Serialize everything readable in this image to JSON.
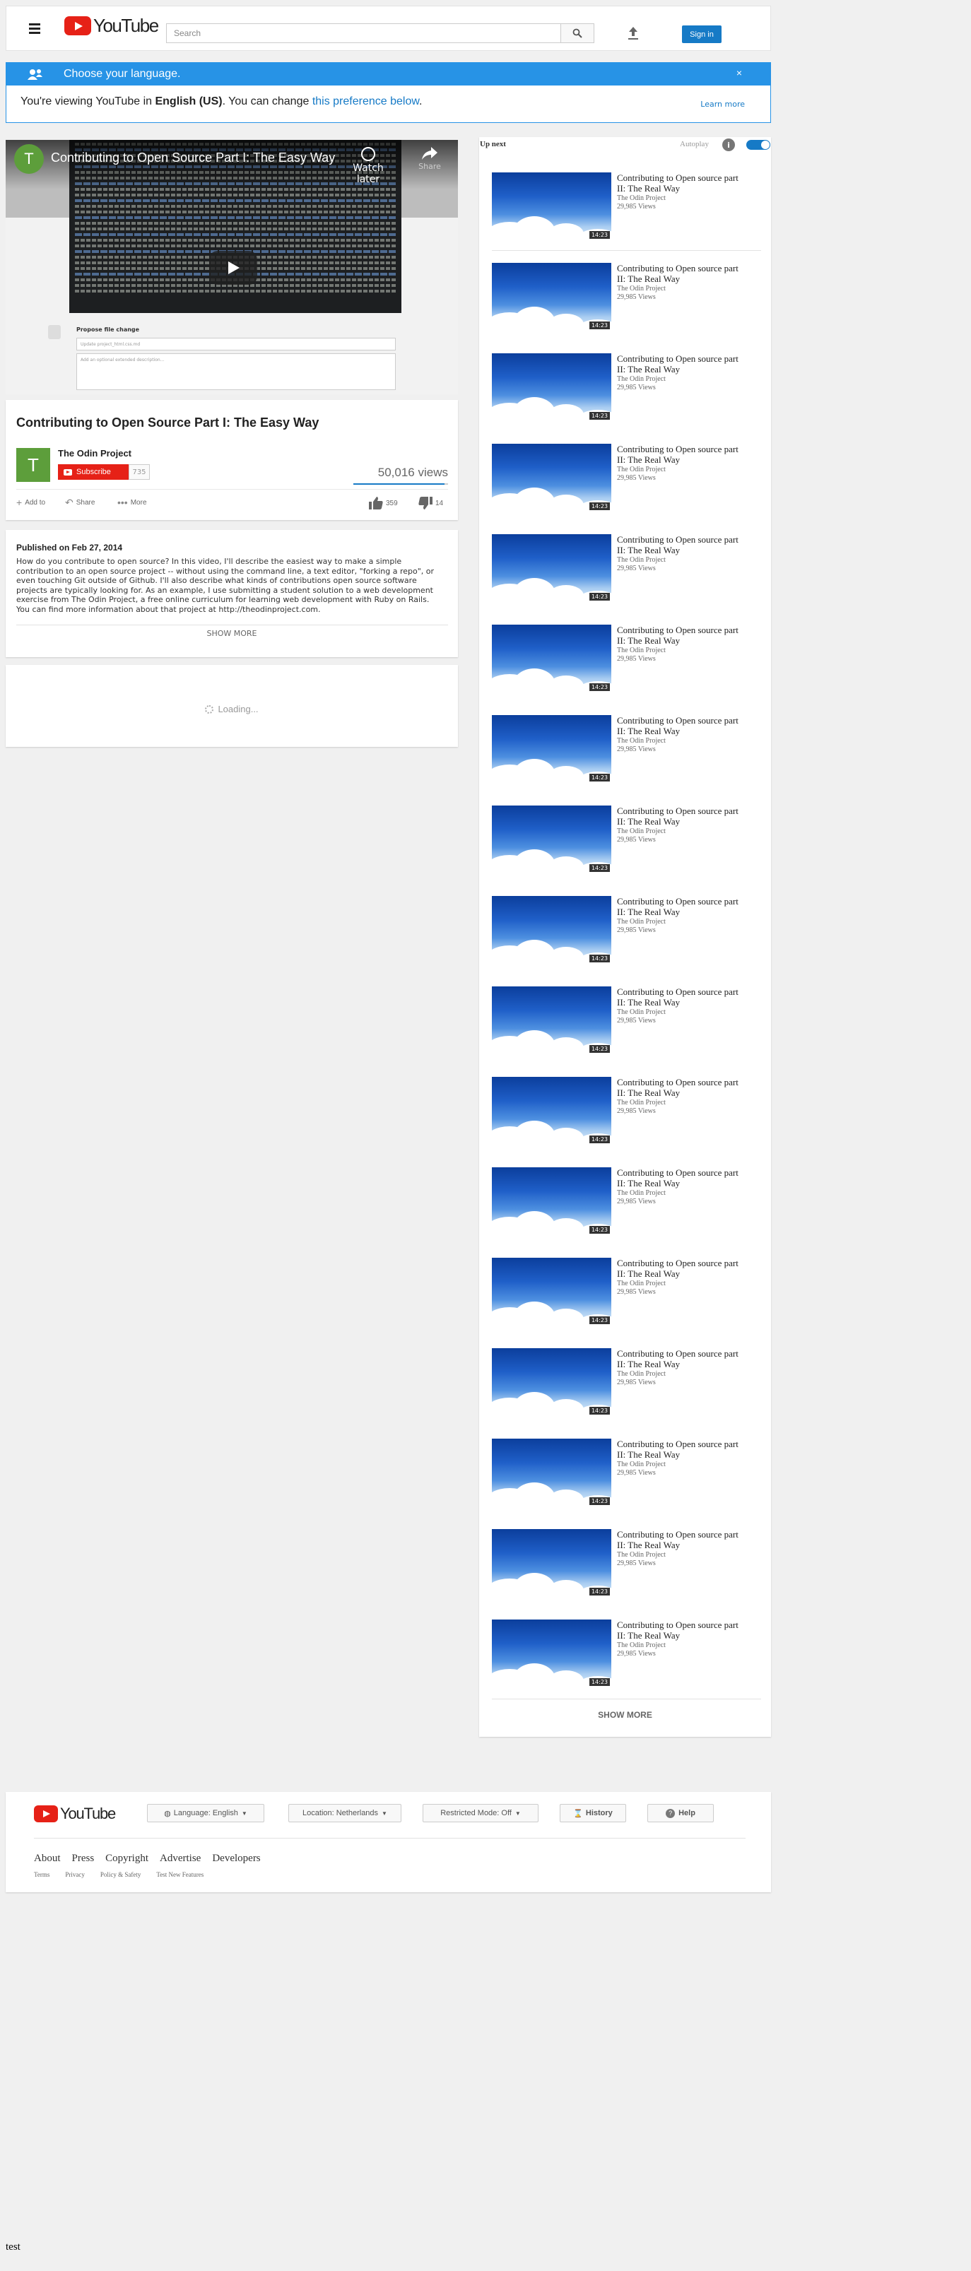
{
  "header": {
    "logo_text": "YouTube",
    "search_placeholder": "Search",
    "signin_label": "Sign in"
  },
  "language_banner": {
    "title": "Choose your language.",
    "close": "×",
    "body_prefix": "You're viewing YouTube in ",
    "body_language": "English (US)",
    "body_middle": ". You can change ",
    "body_link": "this preference below",
    "body_suffix": ".",
    "learn_more": "Learn more"
  },
  "player": {
    "channel_initial": "T",
    "title": "Contributing to Open Source Part I: The Easy Way",
    "watch_later": "Watch later",
    "share": "Share",
    "propose_label": "Propose file change",
    "field1_placeholder": "Update project_html.css.md",
    "field2_placeholder": "Add an optional extended description..."
  },
  "video_info": {
    "title": "Contributing to Open Source Part I: The Easy Way",
    "channel_initial": "T",
    "channel_name": "The Odin Project",
    "subscribe_label": "Subscribe",
    "subscriber_count": "735",
    "views": "50,016 views",
    "like_ratio": 0.96,
    "add_to": "Add to",
    "share": "Share",
    "more": "More",
    "likes": "359",
    "dislikes": "14"
  },
  "description": {
    "published": "Published on Feb 27, 2014",
    "text": "How do you contribute to open source? In this video, I'll describe the easiest way to make a simple contribution to an open source project -- without using the command line, a text editor, \"forking a repo\", or even touching Git outside of Github. I'll also describe what kinds of contributions open source software projects are typically looking for. As an example, I use submitting a student solution to a web development exercise from The Odin Project, a free online curriculum for learning web development with Ruby on Rails. You can find more information about that project at http://theodinproject.com.",
    "show_more": "SHOW MORE"
  },
  "comments": {
    "loading": "Loading..."
  },
  "sidebar": {
    "up_next": "Up next",
    "autoplay": "Autoplay",
    "autoplay_info": "i",
    "autoplay_on": true,
    "videos": [
      {
        "title": "Contributing to Open source part II: The Real Way",
        "channel": "The Odin Project",
        "views": "29,985 Views",
        "duration": "14:23"
      },
      {
        "title": "Contributing to Open source part II: The Real Way",
        "channel": "The Odin Project",
        "views": "29,985 Views",
        "duration": "14:23"
      },
      {
        "title": "Contributing to Open source part II: The Real Way",
        "channel": "The Odin Project",
        "views": "29,985 Views",
        "duration": "14:23"
      },
      {
        "title": "Contributing to Open source part II: The Real Way",
        "channel": "The Odin Project",
        "views": "29,985 Views",
        "duration": "14:23"
      },
      {
        "title": "Contributing to Open source part II: The Real Way",
        "channel": "The Odin Project",
        "views": "29,985 Views",
        "duration": "14:23"
      },
      {
        "title": "Contributing to Open source part II: The Real Way",
        "channel": "The Odin Project",
        "views": "29,985 Views",
        "duration": "14:23"
      },
      {
        "title": "Contributing to Open source part II: The Real Way",
        "channel": "The Odin Project",
        "views": "29,985 Views",
        "duration": "14:23"
      },
      {
        "title": "Contributing to Open source part II: The Real Way",
        "channel": "The Odin Project",
        "views": "29,985 Views",
        "duration": "14:23"
      },
      {
        "title": "Contributing to Open source part II: The Real Way",
        "channel": "The Odin Project",
        "views": "29,985 Views",
        "duration": "14:23"
      },
      {
        "title": "Contributing to Open source part II: The Real Way",
        "channel": "The Odin Project",
        "views": "29,985 Views",
        "duration": "14:23"
      },
      {
        "title": "Contributing to Open source part II: The Real Way",
        "channel": "The Odin Project",
        "views": "29,985 Views",
        "duration": "14:23"
      },
      {
        "title": "Contributing to Open source part II: The Real Way",
        "channel": "The Odin Project",
        "views": "29,985 Views",
        "duration": "14:23"
      },
      {
        "title": "Contributing to Open source part II: The Real Way",
        "channel": "The Odin Project",
        "views": "29,985 Views",
        "duration": "14:23"
      },
      {
        "title": "Contributing to Open source part II: The Real Way",
        "channel": "The Odin Project",
        "views": "29,985 Views",
        "duration": "14:23"
      },
      {
        "title": "Contributing to Open source part II: The Real Way",
        "channel": "The Odin Project",
        "views": "29,985 Views",
        "duration": "14:23"
      },
      {
        "title": "Contributing to Open source part II: The Real Way",
        "channel": "The Odin Project",
        "views": "29,985 Views",
        "duration": "14:23"
      },
      {
        "title": "Contributing to Open source part II: The Real Way",
        "channel": "The Odin Project",
        "views": "29,985 Views",
        "duration": "14:23"
      }
    ],
    "show_more": "SHOW MORE"
  },
  "footer": {
    "logo_text": "YouTube",
    "language": "Language: English",
    "location": "Location: Netherlands",
    "restricted": "Restricted Mode: Off",
    "history": "History",
    "help": "Help",
    "links": [
      "About",
      "Press",
      "Copyright",
      "Advertise",
      "Developers"
    ],
    "sublinks": [
      "Terms",
      "Privacy",
      "Policy & Safety",
      "Test New Features"
    ]
  },
  "bottom_text": "test",
  "colors": {
    "brand_red": "#e62117",
    "accent_blue": "#167ac6",
    "banner_blue": "#2793e6"
  }
}
